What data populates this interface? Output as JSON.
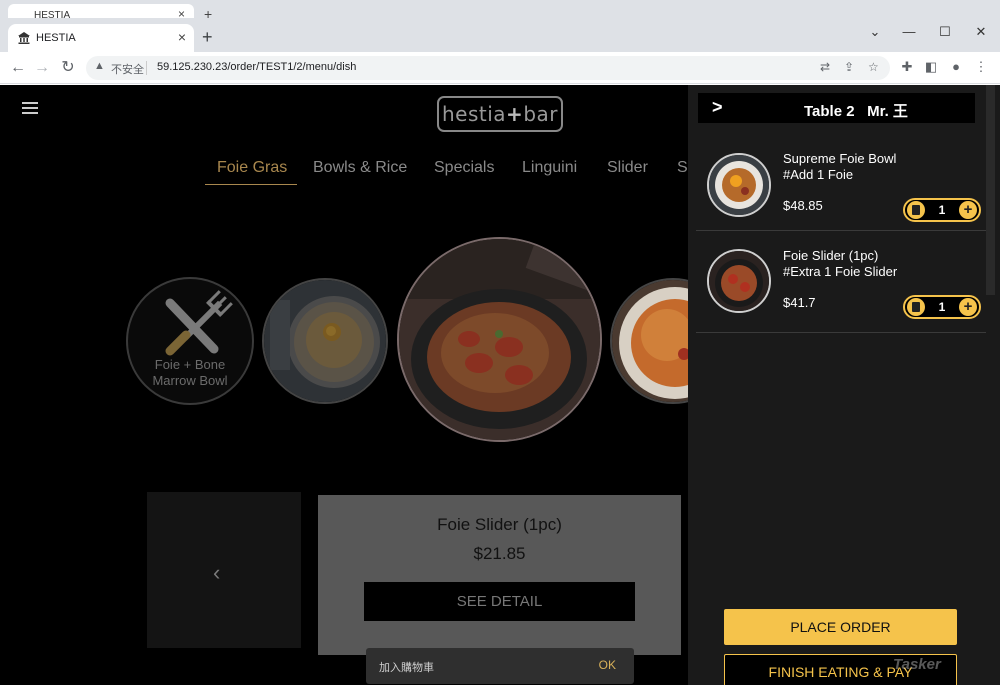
{
  "browser": {
    "background_tab_title": "HESTIA",
    "tab_title": "HESTIA",
    "new_tab_label": "+",
    "security_label": "不安全",
    "url": "59.125.230.23/order/TEST1/2/menu/dish",
    "window_controls": [
      "chevron-down-icon",
      "minimize-icon",
      "maximize-icon",
      "close-icon"
    ]
  },
  "page": {
    "logo_left": "hestia",
    "logo_plus": "+",
    "logo_right": "bar",
    "categories": [
      "Foie Gras",
      "Bowls & Rice",
      "Specials",
      "Linguini",
      "Slider",
      "Si"
    ],
    "active_category": "Foie Gras",
    "featured_icon_label_line1": "Foie + Bone",
    "featured_icon_label_line2": "Marrow Bowl",
    "dish_card": {
      "title": "Foie Slider (1pc)",
      "price": "$21.85",
      "detail_button": "SEE DETAIL"
    },
    "snackbar": {
      "message": "加入購物車",
      "action": "OK"
    }
  },
  "cart": {
    "title": "Table 2   Mr. 王",
    "items": [
      {
        "name_line1": "Supreme Foie Bowl",
        "name_line2": "#Add 1 Foie",
        "price": "$48.85",
        "qty": "1"
      },
      {
        "name_line1": "Foie Slider (1pc)",
        "name_line2": "#Extra 1 Foie Slider",
        "price": "$41.7",
        "qty": "1"
      }
    ],
    "place_order_label": "PLACE ORDER",
    "finish_pay_label": "FINISH EATING & PAY"
  },
  "colors": {
    "accent": "#f5c34b",
    "active_category": "#a8874e",
    "page_bg": "#000000",
    "panel_bg": "#1a1a1a"
  },
  "watermark": "Tasker"
}
